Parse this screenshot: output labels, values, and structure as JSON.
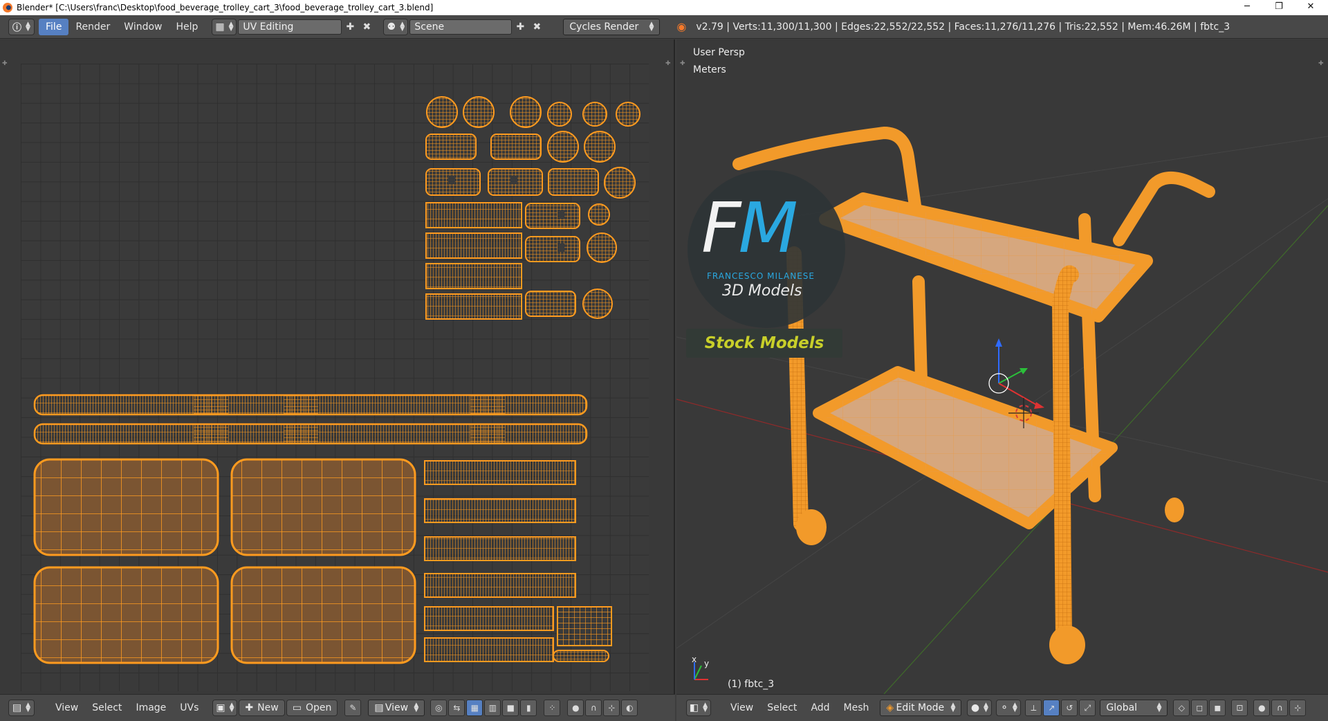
{
  "window": {
    "title": "Blender* [C:\\Users\\franc\\Desktop\\food_beverage_trolley_cart_3\\food_beverage_trolley_cart_3.blend]",
    "minimize": "─",
    "restore": "❐",
    "close": "✕"
  },
  "info_header": {
    "menus": [
      "File",
      "Render",
      "Window",
      "Help"
    ],
    "screen_layout": "UV Editing",
    "scene": "Scene",
    "render_engine": "Cycles Render",
    "stats": "v2.79 | Verts:11,300/11,300 | Edges:22,552/22,552 | Faces:11,276/11,276 | Tris:22,552 | Mem:46.26M | fbtc_3"
  },
  "viewport": {
    "view_name": "User Persp",
    "units": "Meters",
    "object_label": "(1) fbtc_3",
    "axis_x": "x",
    "axis_y": "y"
  },
  "logo": {
    "letters_f": "F",
    "letters_m": "M",
    "name": "FRANCESCO MILANESE",
    "tagline": "3D Models",
    "banner": "Stock Models"
  },
  "uv_footer": {
    "menus": [
      "View",
      "Select",
      "Image",
      "UVs"
    ],
    "new_label": "New",
    "open_label": "Open",
    "view_label": "View"
  },
  "vp_footer": {
    "menus": [
      "View",
      "Select",
      "Add",
      "Mesh"
    ],
    "mode": "Edit Mode",
    "orientation": "Global"
  },
  "colors": {
    "accent": "#5680c2",
    "uv_orange": "#ff9b1f",
    "uv_fill": "#7b5532",
    "mesh_orange": "#f29a2a",
    "logo_blue": "#2aa8e0"
  }
}
